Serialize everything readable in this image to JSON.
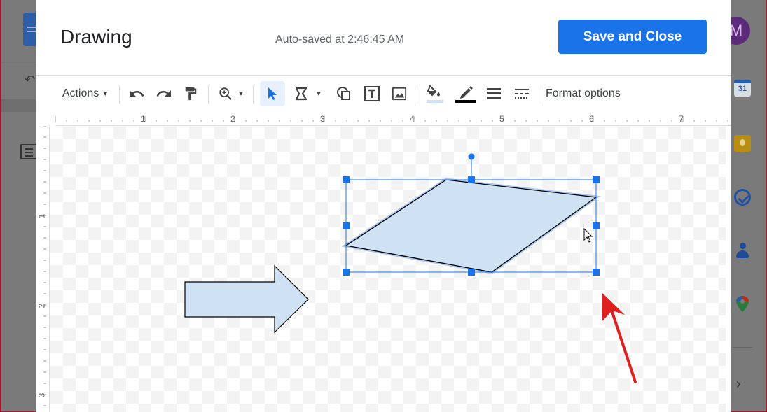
{
  "background": {
    "avatar_letter": "M",
    "calendar_day": "31",
    "side_apps": [
      "calendar-icon",
      "keep-icon",
      "tasks-icon",
      "contacts-icon",
      "maps-icon"
    ]
  },
  "dialog": {
    "title": "Drawing",
    "autosave": "Auto-saved at 2:46:45 AM",
    "save_label": "Save and Close"
  },
  "toolbar": {
    "actions_label": "Actions",
    "format_label": "Format options",
    "tools": [
      "undo-icon",
      "redo-icon",
      "paint-format-icon",
      "zoom-icon",
      "select-icon",
      "line-icon",
      "shape-icon",
      "text-box-icon",
      "image-icon",
      "fill-color-icon",
      "border-color-icon",
      "border-weight-icon",
      "border-dash-icon"
    ]
  },
  "ruler": {
    "top_numbers": [
      "1",
      "2",
      "3",
      "4",
      "5",
      "6",
      "7"
    ],
    "left_numbers": [
      "1",
      "2",
      "3"
    ]
  },
  "colors": {
    "accent": "#1a73e8",
    "shape_fill": "#cfe2f3",
    "annotation_arrow": "#e02020"
  }
}
